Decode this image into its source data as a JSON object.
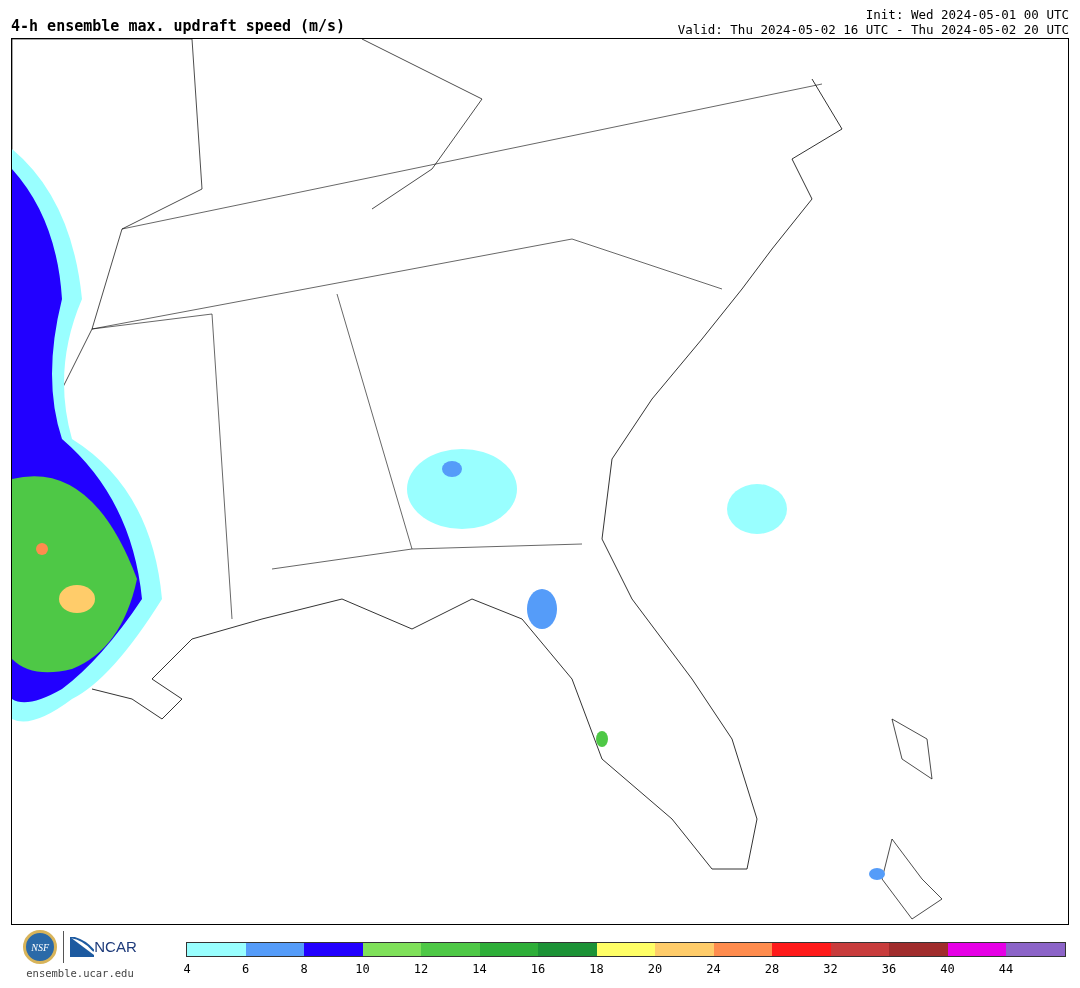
{
  "title": "4-h ensemble max. updraft speed (m/s)",
  "init": "Init: Wed 2024-05-01 00 UTC",
  "valid": "Valid: Thu 2024-05-02 16 UTC - Thu 2024-05-02 20 UTC",
  "footer": {
    "logo_nsf": "NSF",
    "logo_ncar": "NCAR",
    "url": "ensemble.ucar.edu"
  },
  "colorbar": {
    "bins": [
      {
        "color": "#99ffff"
      },
      {
        "color": "#559cf9"
      },
      {
        "color": "#2200ff"
      },
      {
        "color": "#7fe05a"
      },
      {
        "color": "#4ec846"
      },
      {
        "color": "#2eae38"
      },
      {
        "color": "#1c9236"
      },
      {
        "color": "#ffff66"
      },
      {
        "color": "#ffcc6a"
      },
      {
        "color": "#ff8c4e"
      },
      {
        "color": "#ff1a1a"
      },
      {
        "color": "#c83c3c"
      },
      {
        "color": "#a02c2c"
      },
      {
        "color": "#e600e6"
      },
      {
        "color": "#8c64c8"
      }
    ],
    "ticks": [
      "4",
      "6",
      "8",
      "10",
      "12",
      "14",
      "16",
      "18",
      "20",
      "24",
      "28",
      "32",
      "36",
      "40",
      "44"
    ]
  }
}
